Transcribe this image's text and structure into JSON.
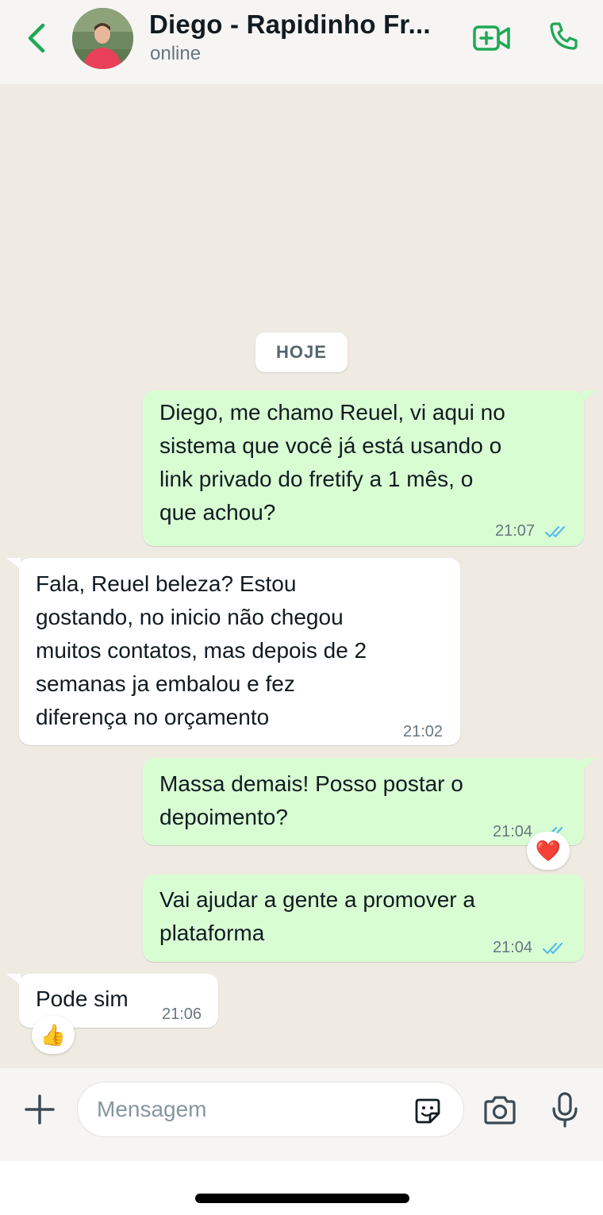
{
  "header": {
    "contact_name": "Diego - Rapidinho Fr...",
    "status": "online",
    "back_icon": "chevron-left-icon",
    "video_icon": "video-plus-icon",
    "call_icon": "phone-icon",
    "accent_color": "#1fa855"
  },
  "chat": {
    "date_chip": "HOJE",
    "messages": [
      {
        "direction": "outgoing",
        "lines": [
          "Diego, me chamo Reuel, vi aqui no",
          "sistema que você já está usando o",
          "link privado do fretify a 1 mês, o",
          "que achou?"
        ],
        "time": "21:07",
        "read_icon": "double-check-icon"
      },
      {
        "direction": "incoming",
        "lines": [
          "Fala, Reuel beleza? Estou",
          "gostando, no inicio não chegou",
          "muitos contatos, mas depois de 2",
          "semanas ja embalou e fez",
          "diferença no orçamento"
        ],
        "time": "21:02"
      },
      {
        "direction": "outgoing",
        "lines": [
          "Massa demais! Posso postar o",
          "depoimento?"
        ],
        "time": "21:04",
        "read_icon": "double-check-icon",
        "reaction": "❤️"
      },
      {
        "direction": "outgoing",
        "lines": [
          "Vai ajudar a gente a promover a",
          "plataforma"
        ],
        "time": "21:04",
        "read_icon": "double-check-icon"
      },
      {
        "direction": "incoming",
        "lines": [
          "Pode sim"
        ],
        "time": "21:06",
        "reaction": "👍"
      }
    ]
  },
  "composer": {
    "placeholder": "Mensagem",
    "plus_icon": "plus-icon",
    "sticker_icon": "sticker-icon",
    "camera_icon": "camera-icon",
    "mic_icon": "microphone-icon"
  },
  "colors": {
    "outgoing_bubble": "#d9fdd3",
    "incoming_bubble": "#ffffff",
    "chat_background": "#efeae2",
    "read_ticks": "#53bdeb"
  }
}
